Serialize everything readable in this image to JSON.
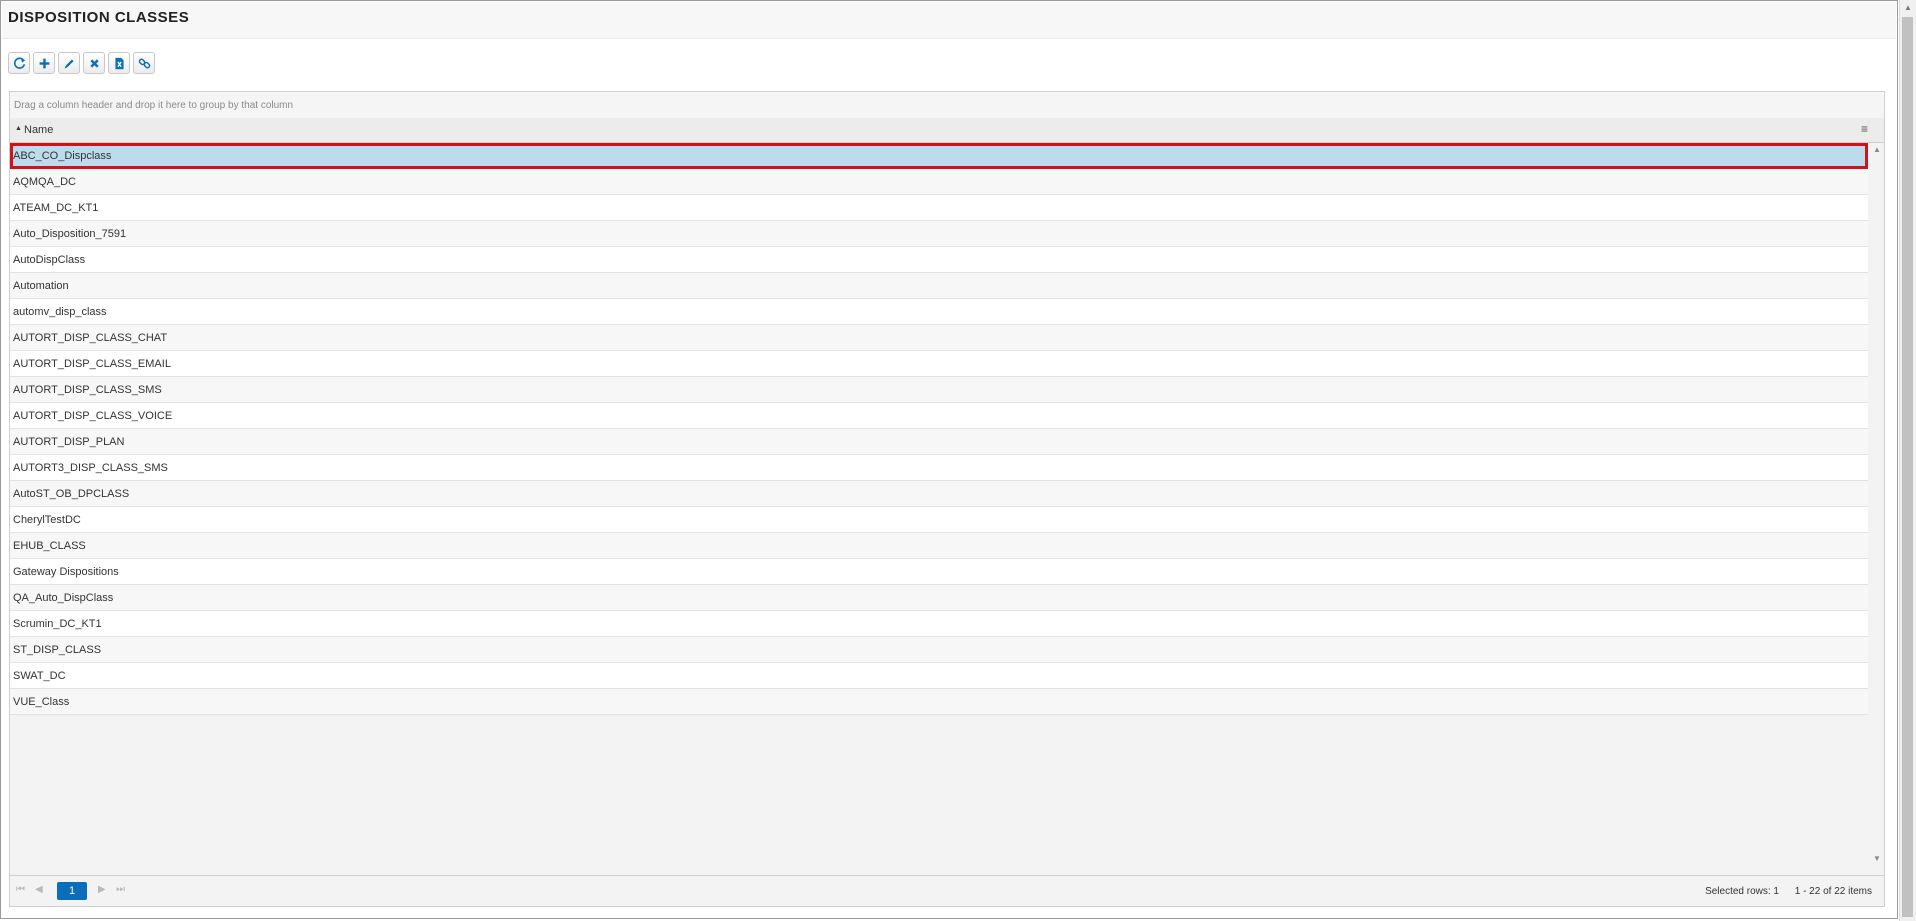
{
  "page": {
    "title": "DISPOSITION CLASSES"
  },
  "toolbar": {
    "buttons": [
      {
        "name": "refresh",
        "icon": "refresh-icon"
      },
      {
        "name": "add",
        "icon": "plus-icon"
      },
      {
        "name": "edit",
        "icon": "pencil-icon"
      },
      {
        "name": "delete",
        "icon": "x-icon"
      },
      {
        "name": "export-excel",
        "icon": "excel-icon"
      },
      {
        "name": "link",
        "icon": "link-icon"
      }
    ],
    "accent_color": "#0a6ebd"
  },
  "grid": {
    "group_panel_text": "Drag a column header and drop it here to group by that column",
    "column_header": "Name",
    "sort_indicator": "▲",
    "column_menu_icon": "≡",
    "selected_index": 0,
    "rows": [
      "ABC_CO_Dispclass",
      "AQMQA_DC",
      "ATEAM_DC_KT1",
      "Auto_Disposition_7591",
      "AutoDispClass",
      "Automation",
      "automv_disp_class",
      "AUTORT_DISP_CLASS_CHAT",
      "AUTORT_DISP_CLASS_EMAIL",
      "AUTORT_DISP_CLASS_SMS",
      "AUTORT_DISP_CLASS_VOICE",
      "AUTORT_DISP_PLAN",
      "AUTORT3_DISP_CLASS_SMS",
      "AutoST_OB_DPCLASS",
      "CherylTestDC",
      "EHUB_CLASS",
      "Gateway Dispositions",
      "QA_Auto_DispClass",
      "Scrumin_DC_KT1",
      "ST_DISP_CLASS",
      "SWAT_DC",
      "VUE_Class"
    ]
  },
  "pager": {
    "first": "⏮",
    "prev": "◀",
    "current_page": "1",
    "next": "▶",
    "last": "⏭",
    "selected_rows": "Selected rows: 1",
    "items_info": "1 - 22 of 22 items"
  },
  "colors": {
    "selected_row_bg": "#bcdcec",
    "selected_row_border": "#d0121b"
  }
}
